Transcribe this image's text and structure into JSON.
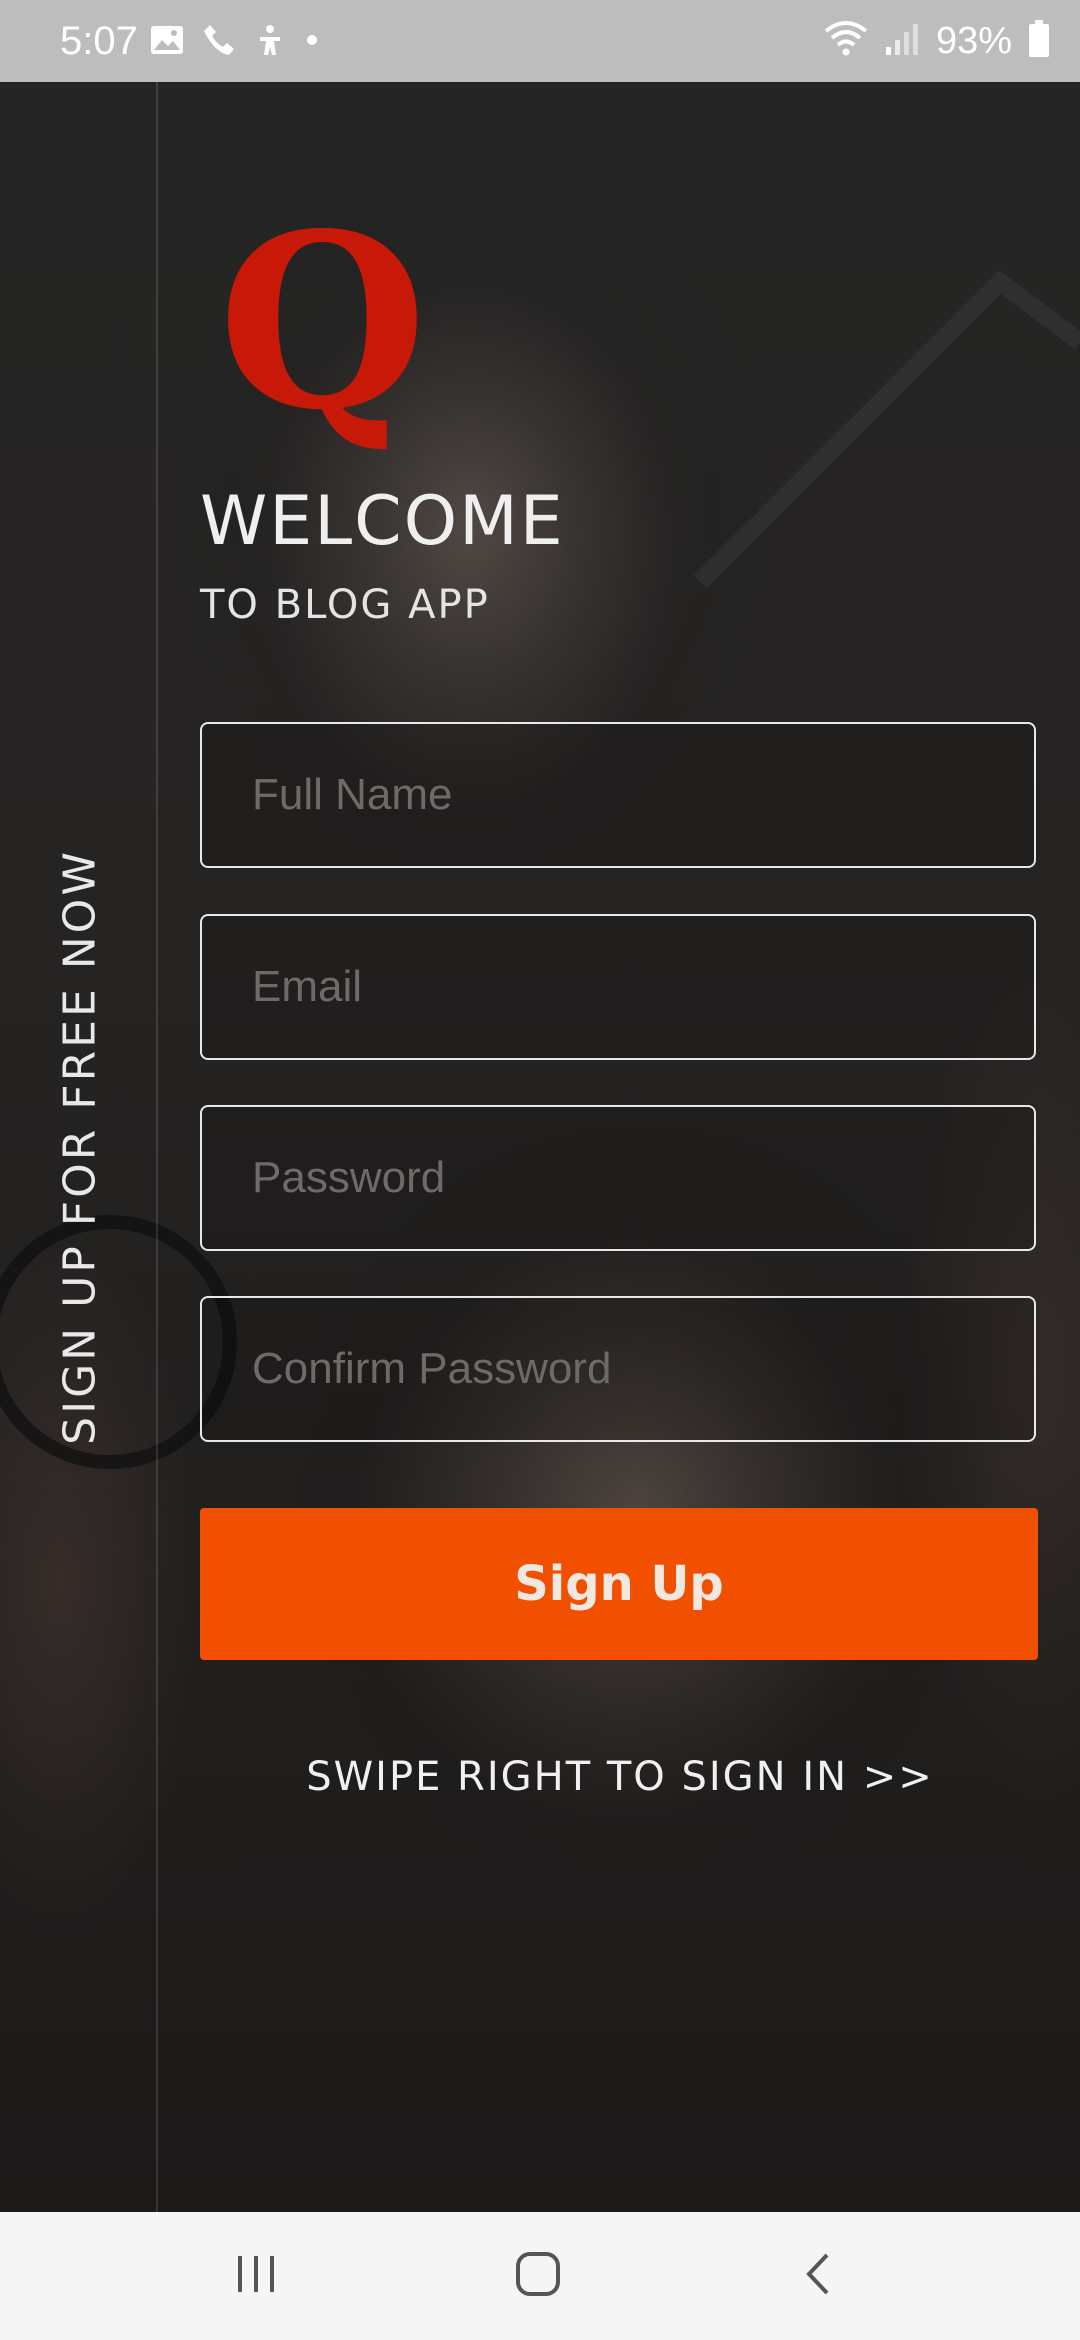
{
  "status_bar": {
    "time": "5:07",
    "battery_text": "93%",
    "icons_left": [
      "image-icon",
      "phone-icon",
      "accessibility-icon",
      "dot-icon"
    ],
    "icons_right": [
      "wifi-icon",
      "signal-icon",
      "battery-icon"
    ]
  },
  "side_panel": {
    "label": "SIGN UP FOR FREE NOW"
  },
  "logo": {
    "letter": "Q",
    "color": "#c81808"
  },
  "header": {
    "title": "WELCOME",
    "subtitle": "TO BLOG APP"
  },
  "form": {
    "full_name_placeholder": "Full Name",
    "email_placeholder": "Email",
    "password_placeholder": "Password",
    "confirm_password_placeholder": "Confirm Password",
    "submit_label": "Sign Up",
    "submit_color": "#f05000"
  },
  "footer": {
    "swipe_text": "SWIPE RIGHT TO SIGN IN >>"
  },
  "nav_bar": {
    "buttons": [
      "recent-apps-icon",
      "home-icon",
      "back-icon"
    ]
  }
}
